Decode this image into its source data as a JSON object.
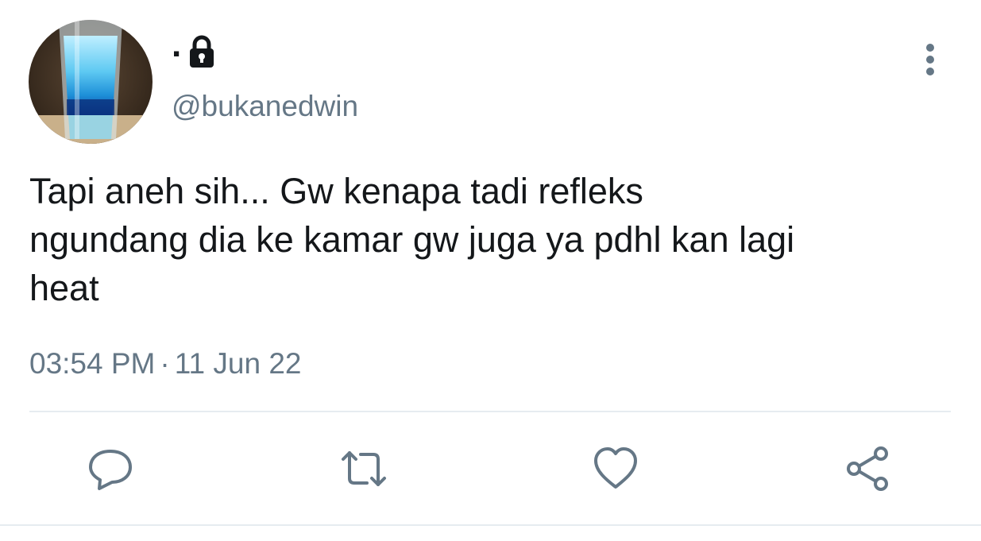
{
  "user": {
    "display_name": ".",
    "handle": "@bukanedwin",
    "protected": true
  },
  "tweet": {
    "text": "Tapi aneh sih... Gw kenapa tadi refleks\nngundang dia ke kamar gw juga ya pdhl kan lagi\nheat",
    "time": "03:54 PM",
    "separator": "·",
    "date": "11 Jun 22"
  },
  "icons": {
    "avatar": "avatar-glass-blue-drink",
    "lock": "lock-icon",
    "more": "more-vertical-icon",
    "reply": "reply-icon",
    "retweet": "retweet-icon",
    "like": "heart-icon",
    "share": "share-icon"
  },
  "colors": {
    "text_primary": "#14171a",
    "text_secondary": "#657786",
    "icon": "#657786",
    "divider": "#e6ecf0",
    "background": "#ffffff"
  }
}
